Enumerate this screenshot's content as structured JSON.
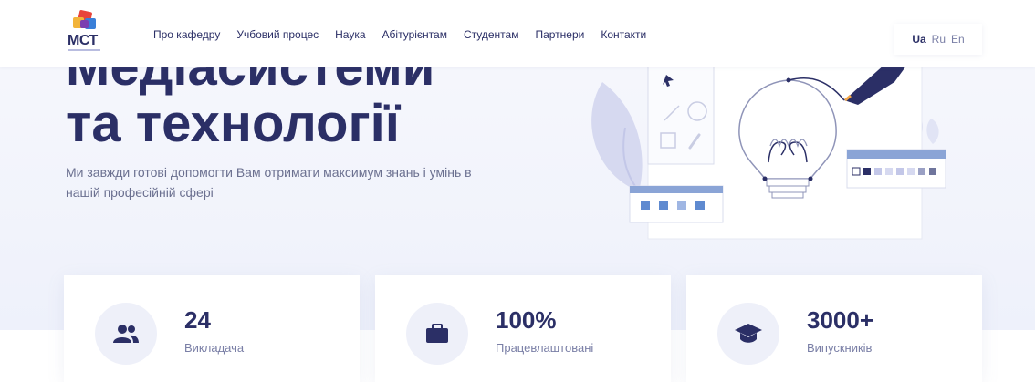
{
  "brand": {
    "logo_text": "МСТ",
    "colors": {
      "navy": "#2b2f66",
      "accent": "#3b4a8f"
    }
  },
  "nav": {
    "items": [
      {
        "label": "Про кафедру"
      },
      {
        "label": "Учбовий процес"
      },
      {
        "label": "Наука"
      },
      {
        "label": "Абітурієнтам"
      },
      {
        "label": "Студентам"
      },
      {
        "label": "Партнери"
      },
      {
        "label": "Контакти"
      }
    ]
  },
  "languages": {
    "active": "Ua",
    "others": [
      "Ru",
      "En"
    ]
  },
  "hero": {
    "title_line1": "Медіасистеми",
    "title_line2": "та технології",
    "subtitle": "Ми завжди готові допомогти Вам отримати максимум знань і умінь в нашій професійній сфері"
  },
  "stats": [
    {
      "value": "24",
      "label": "Викладача",
      "icon": "users-icon"
    },
    {
      "value": "100%",
      "label": "Працевлаштовані",
      "icon": "briefcase-icon"
    },
    {
      "value": "3000+",
      "label": "Випускників",
      "icon": "graduation-cap-icon"
    }
  ]
}
